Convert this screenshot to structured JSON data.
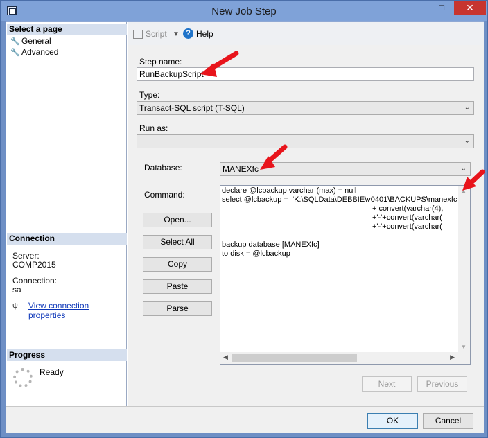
{
  "window": {
    "title": "New Job Step",
    "minimize": "–",
    "maximize": "□",
    "close": "✕"
  },
  "left": {
    "select_page_header": "Select a page",
    "pages": [
      "General",
      "Advanced"
    ],
    "connection_header": "Connection",
    "server_label": "Server:",
    "server_value": "COMP2015",
    "connection_label": "Connection:",
    "connection_value": "sa",
    "view_connection_properties": "View connection properties",
    "progress_header": "Progress",
    "progress_status": "Ready"
  },
  "toolbar": {
    "script_label": "Script",
    "help_label": "Help",
    "help_icon": "?"
  },
  "form": {
    "step_name_label": "Step name:",
    "step_name_value": "RunBackupScript",
    "type_label": "Type:",
    "type_value": "Transact-SQL script (T-SQL)",
    "run_as_label": "Run as:",
    "run_as_value": "",
    "database_label": "Database:",
    "database_value": "MANEXfc",
    "command_label": "Command:",
    "command_lines": [
      "declare @lcbackup varchar (max) = null",
      "select @lcbackup =  'K:\\SQLData\\DEBBIE\\v0401\\BACKUPS\\manexfc",
      "                                                                       + convert(varchar(4),",
      "                                                                       +'-'+convert(varchar(",
      "                                                                       +'-'+convert(varchar(",
      "",
      "backup database [MANEXfc]",
      "to disk = @lcbackup"
    ],
    "buttons": {
      "open": "Open...",
      "select_all": "Select All",
      "copy": "Copy",
      "paste": "Paste",
      "parse": "Parse"
    },
    "next": "Next",
    "previous": "Previous"
  },
  "footer": {
    "ok": "OK",
    "cancel": "Cancel"
  },
  "colors": {
    "title_bar": "#7fa2d8",
    "close_button": "#c7352f",
    "annotation_arrow": "#e8141b",
    "link": "#0b35b8"
  }
}
